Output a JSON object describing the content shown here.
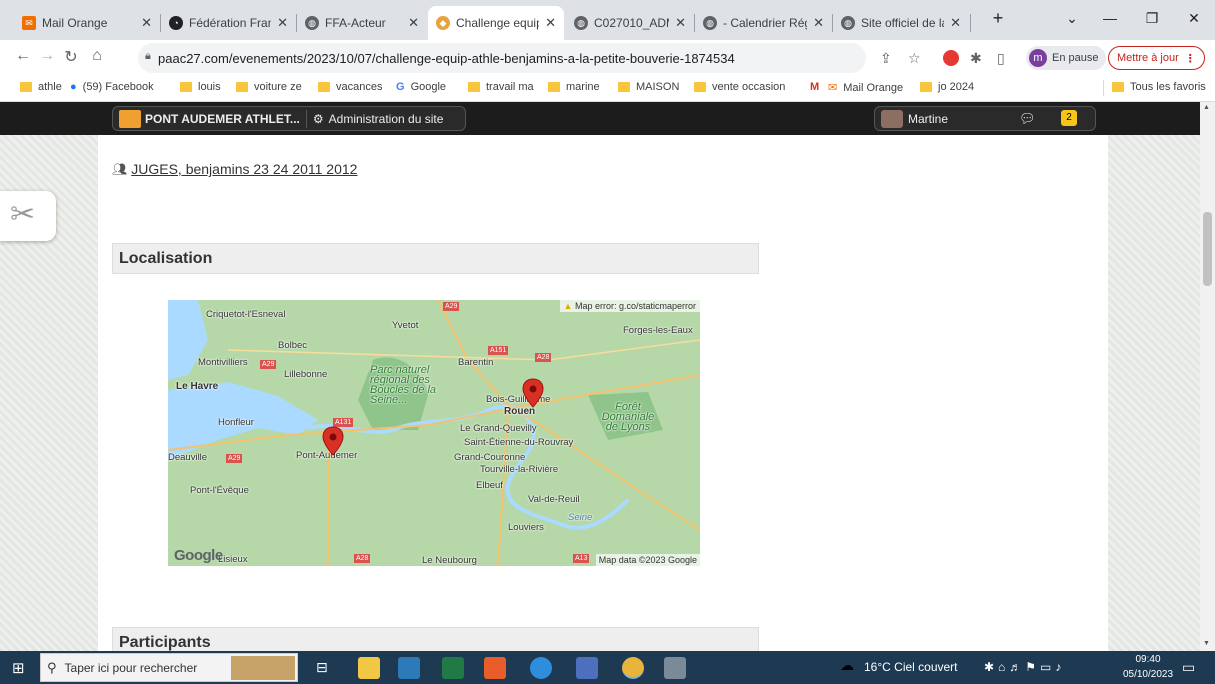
{
  "browser": {
    "tabs": [
      {
        "title": "Mail Orange",
        "icon": "mail-icon",
        "color": "#f16e00"
      },
      {
        "title": "Fédération Franç",
        "icon": "ffa-icon",
        "color": "#202124"
      },
      {
        "title": "FFA-Acteur",
        "icon": "globe-icon",
        "color": "#5f6368"
      },
      {
        "title": "Challenge equip",
        "icon": "club-icon",
        "color": "#e8a33c"
      },
      {
        "title": "C027010_ADM Fr",
        "icon": "globe-icon",
        "color": "#5f6368"
      },
      {
        "title": "- Calendrier Régi",
        "icon": "globe-icon",
        "color": "#5f6368"
      },
      {
        "title": "Site officiel de la",
        "icon": "globe-icon",
        "color": "#5f6368"
      }
    ],
    "url": "paac27.com/evenements/2023/10/07/challenge-equip-athle-benjamins-a-la-petite-bouverie-1874534",
    "profile_initial": "m",
    "profile_status": "En pause",
    "update_label": "Mettre à jour",
    "bookmarks": [
      {
        "label": "athle",
        "type": "folder"
      },
      {
        "label": "(59) Facebook",
        "type": "facebook"
      },
      {
        "label": "louis",
        "type": "folder"
      },
      {
        "label": "voiture ze",
        "type": "folder"
      },
      {
        "label": "vacances",
        "type": "folder"
      },
      {
        "label": "Google",
        "type": "google"
      },
      {
        "label": "travail ma",
        "type": "folder"
      },
      {
        "label": "marine",
        "type": "folder"
      },
      {
        "label": "MAISON",
        "type": "folder"
      },
      {
        "label": "vente occasion",
        "type": "folder"
      },
      {
        "label": "",
        "type": "gmail"
      },
      {
        "label": "Mail Orange",
        "type": "mail"
      },
      {
        "label": "jo 2024",
        "type": "folder"
      }
    ],
    "all_bookmarks": "Tous les favoris"
  },
  "sitebar": {
    "site_name": "PONT AUDEMER ATHLET...",
    "admin_label": "Administration du site",
    "user_name": "Martine",
    "notif_count": "2"
  },
  "content": {
    "juges_link": "JUGES, benjamins 23 24 2011 2012",
    "localisation_title": "Localisation",
    "participants_title": "Participants"
  },
  "map": {
    "error_text": "Map error: g.co/staticmaperror",
    "copyright": "Map data ©2023 Google",
    "google_logo": "Google",
    "places": [
      {
        "name": "Criquetot-l'Esneval",
        "kind": "town"
      },
      {
        "name": "Yvetot",
        "kind": "town"
      },
      {
        "name": "Forges-les-Eaux",
        "kind": "town"
      },
      {
        "name": "Bolbec",
        "kind": "town"
      },
      {
        "name": "Montivilliers",
        "kind": "town"
      },
      {
        "name": "Barentin",
        "kind": "town"
      },
      {
        "name": "Lillebonne",
        "kind": "town"
      },
      {
        "name": "Le Havre",
        "kind": "city"
      },
      {
        "name": "Bois-Guillaume",
        "kind": "town"
      },
      {
        "name": "Rouen",
        "kind": "city"
      },
      {
        "name": "Honfleur",
        "kind": "town"
      },
      {
        "name": "Le Grand-Quevilly",
        "kind": "town"
      },
      {
        "name": "Saint-Étienne-du-Rouvray",
        "kind": "town"
      },
      {
        "name": "Deauville",
        "kind": "town"
      },
      {
        "name": "Pont-Audemer",
        "kind": "town"
      },
      {
        "name": "Grand-Couronne",
        "kind": "town"
      },
      {
        "name": "Tourville-la-Rivière",
        "kind": "town"
      },
      {
        "name": "Pont-l'Évêque",
        "kind": "town"
      },
      {
        "name": "Elbeuf",
        "kind": "town"
      },
      {
        "name": "Val-de-Reuil",
        "kind": "town"
      },
      {
        "name": "Louviers",
        "kind": "town"
      },
      {
        "name": "Lisieux",
        "kind": "town"
      },
      {
        "name": "Le Neubourg",
        "kind": "town"
      },
      {
        "name": "Seine",
        "kind": "river"
      }
    ],
    "parks": [
      "Parc naturel régional des Boucles de la Seine...",
      "Forêt Domaniale de Lyons"
    ],
    "roads": [
      "A29",
      "A151",
      "A28",
      "A29",
      "A131",
      "A29",
      "A28",
      "A13"
    ]
  },
  "taskbar": {
    "search_placeholder": "Taper ici pour rechercher",
    "weather": "16°C  Ciel couvert",
    "time": "09:40",
    "date": "05/10/2023"
  }
}
